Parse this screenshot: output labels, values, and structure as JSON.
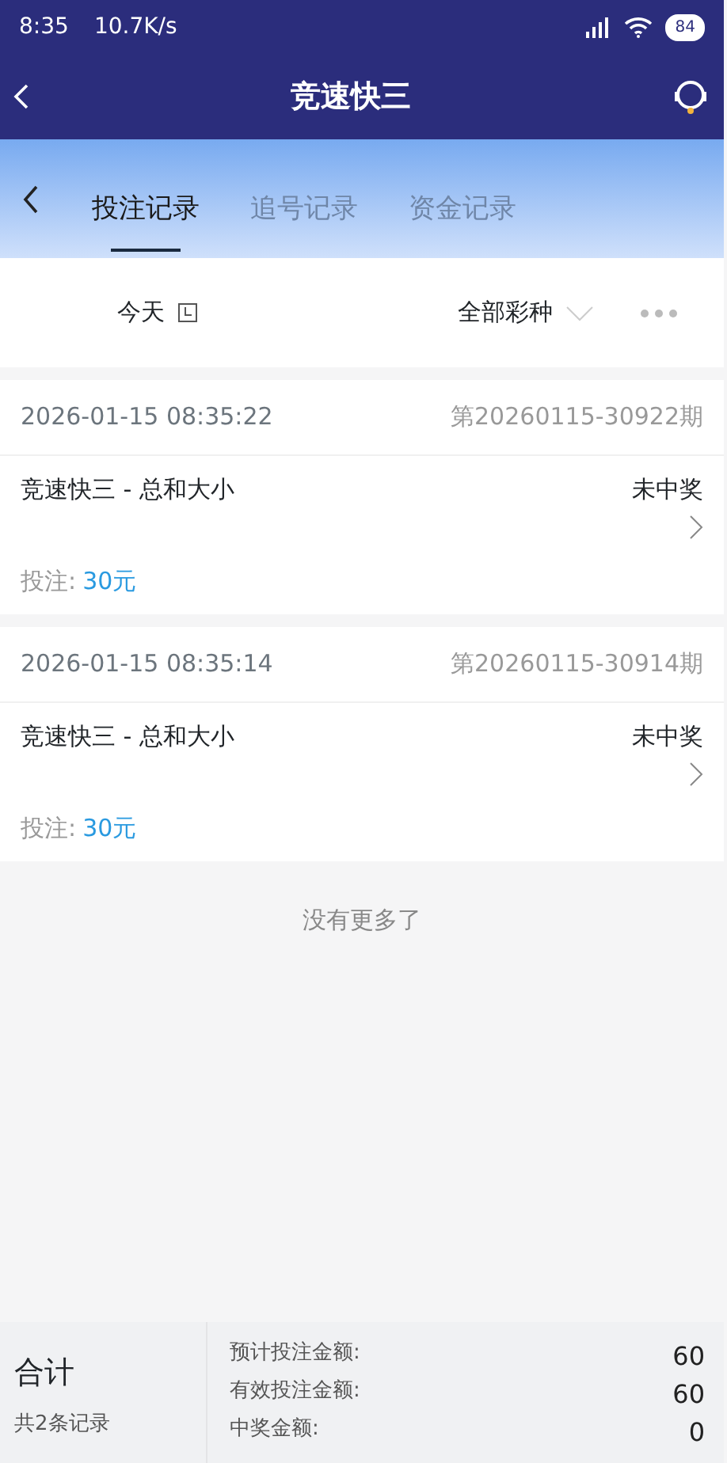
{
  "status_bar": {
    "time": "8:35",
    "speed": "10.7K/s",
    "battery": "84"
  },
  "header": {
    "title": "竞速快三"
  },
  "tabs": [
    {
      "label": "投注记录",
      "selected": true
    },
    {
      "label": "追号记录",
      "selected": false
    },
    {
      "label": "资金记录",
      "selected": false
    }
  ],
  "filters": {
    "date": "今天",
    "lottery": "全部彩种"
  },
  "records": [
    {
      "time": "2026-01-15 08:35:22",
      "issue": "第20260115-30922期",
      "game": "竞速快三 - 总和大小",
      "result": "未中奖",
      "bet_label": "投注:",
      "bet_amount": "30元"
    },
    {
      "time": "2026-01-15 08:35:14",
      "issue": "第20260115-30914期",
      "game": "竞速快三 - 总和大小",
      "result": "未中奖",
      "bet_label": "投注:",
      "bet_amount": "30元"
    }
  ],
  "end_note": "没有更多了",
  "summary": {
    "title": "合计",
    "count": "共2条记录",
    "rows": [
      {
        "label": "预计投注金额:",
        "value": "60"
      },
      {
        "label": "有效投注金额:",
        "value": "60"
      },
      {
        "label": "中奖金额:",
        "value": "0"
      }
    ]
  }
}
